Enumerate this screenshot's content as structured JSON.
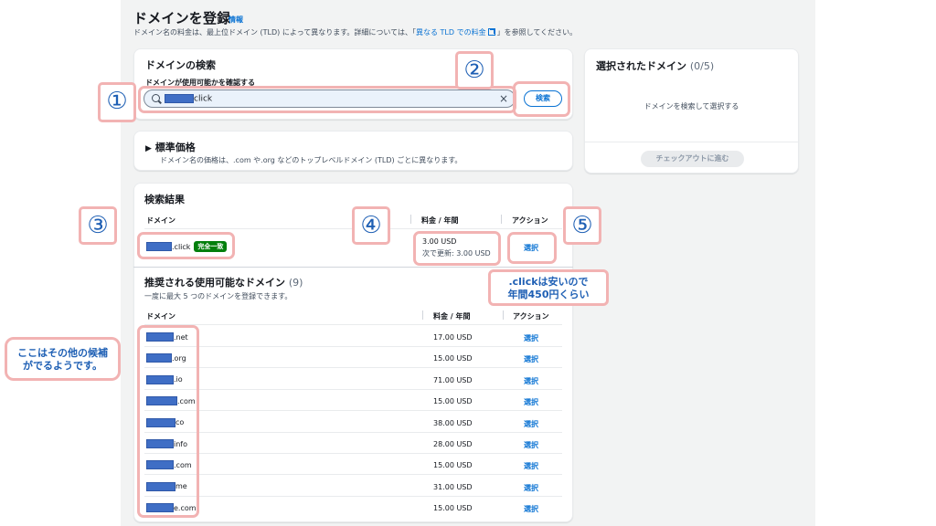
{
  "header": {
    "title": "ドメインを登録",
    "info": "情報",
    "desc_before": "ドメイン名の料金は、最上位ドメイン (TLD) によって異なります。詳細については、「",
    "desc_link": "異なる TLD での料金",
    "desc_after": "」を参照してください。"
  },
  "search": {
    "heading": "ドメインの検索",
    "label": "ドメインが使用可能かを確認する",
    "value_suffix": "click",
    "button": "検索"
  },
  "standard_price": {
    "heading": "標準価格",
    "desc": "ドメイン名の価格は、.com や.org などのトップレベルドメイン (TLD) ごとに異なります。"
  },
  "selected": {
    "heading": "選択されたドメイン",
    "count": "(0/5)",
    "empty": "ドメインを検索して選択する",
    "checkout": "チェックアウトに進む"
  },
  "results": {
    "heading": "検索結果",
    "col_domain": "ドメイン",
    "col_price": "料金 / 年間",
    "col_action": "アクション",
    "row": {
      "domain_suffix": ".click",
      "badge": "完全一致",
      "price": "3.00 USD",
      "renew": "次で更新: 3.00 USD",
      "action": "選択"
    },
    "suggest_heading": "推奨される使用可能なドメイン",
    "suggest_count": "(9)",
    "suggest_sub": "一度に最大 5 つのドメインを登録できます。",
    "suggestions": [
      {
        "suffix": ".net",
        "price": "17.00 USD",
        "action": "選択"
      },
      {
        "suffix": ".org",
        "price": "15.00 USD",
        "action": "選択"
      },
      {
        "suffix": ".io",
        "price": "71.00 USD",
        "action": "選択"
      },
      {
        "suffix": ".com",
        "price": "15.00 USD",
        "action": "選択"
      },
      {
        "suffix": "co",
        "price": "38.00 USD",
        "action": "選択"
      },
      {
        "suffix": "info",
        "price": "28.00 USD",
        "action": "選択"
      },
      {
        "suffix": ".com",
        "price": "15.00 USD",
        "action": "選択"
      },
      {
        "suffix": "me",
        "price": "31.00 USD",
        "action": "選択"
      },
      {
        "suffix": "e.com",
        "price": "15.00 USD",
        "action": "選択"
      }
    ]
  },
  "annotations": {
    "n1": "①",
    "n2": "②",
    "n3": "③",
    "n4": "④",
    "n5": "⑤",
    "note_price_1": ".clickは安いので",
    "note_price_2": "年間450円くらい",
    "note_other_1": "ここはその他の候補",
    "note_other_2": "がでるようです。"
  },
  "colors": {
    "accent": "#0972d3",
    "badge": "#037f0c",
    "annotation_border": "#f2b3b3",
    "annotation_text": "#1e5fb4"
  }
}
